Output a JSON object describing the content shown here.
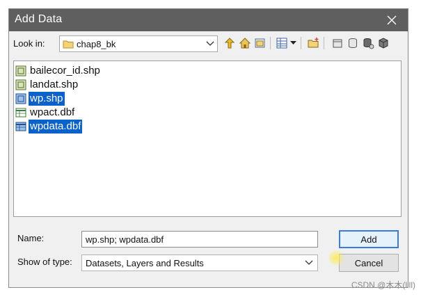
{
  "window": {
    "title": "Add Data"
  },
  "lookin": {
    "label": "Look in:",
    "value": "chap8_bk"
  },
  "toolbar": {
    "icons": [
      "up-one-level-icon",
      "home-icon",
      "connect-folder-icon",
      "view-list-icon",
      "view-dropdown-icon",
      "new-folder-icon",
      "new-geodatabase-icon",
      "new-database-icon",
      "database-connection-icon",
      "server-connection-icon"
    ]
  },
  "files": [
    {
      "name": "bailecor_id.shp",
      "type": "shapefile",
      "selected": false
    },
    {
      "name": "landat.shp",
      "type": "shapefile",
      "selected": false
    },
    {
      "name": "wp.shp",
      "type": "shapefile",
      "selected": true
    },
    {
      "name": "wpact.dbf",
      "type": "table",
      "selected": false
    },
    {
      "name": "wpdata.dbf",
      "type": "table",
      "selected": true
    }
  ],
  "form": {
    "name_label": "Name:",
    "name_value": "wp.shp; wpdata.dbf",
    "type_label": "Show of type:",
    "type_value": "Datasets, Layers and Results"
  },
  "buttons": {
    "add": "Add",
    "cancel": "Cancel"
  },
  "watermark": "CSDN @木木(llll)",
  "colors": {
    "titlebar": "#5f5f5f",
    "selection": "#0a61c9",
    "dialog_bg": "#f0f0f0"
  }
}
